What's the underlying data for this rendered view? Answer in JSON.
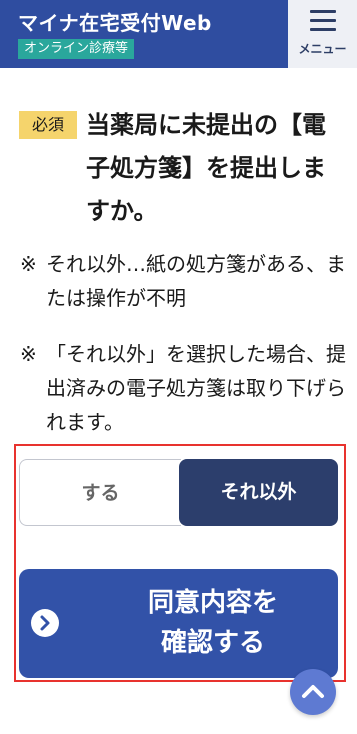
{
  "header": {
    "title": "マイナ在宅受付Web",
    "subtitle": "オンライン診療等",
    "menu_label": "メニュー",
    "menu_icon": "hamburger-icon"
  },
  "question": {
    "badge": "必須",
    "text": "当薬局に未提出の【電子処方箋】を提出しますか。"
  },
  "notes": [
    {
      "mark": "※",
      "text": "それ以外…紙の処方箋がある、または操作が不明"
    },
    {
      "mark": "※",
      "text": "「それ以外」を選択した場合、提出済みの電子処方箋は取り下げられます。"
    }
  ],
  "choices": {
    "options": [
      "する",
      "それ以外"
    ],
    "selected": "それ以外"
  },
  "confirm_button": {
    "label": "同意内容を\n確認する",
    "icon": "chevron-right-circle-icon"
  },
  "scroll_top": {
    "icon": "chevron-up-icon"
  },
  "colors": {
    "header": "#2f4da0",
    "subtitle_badge": "#2aa79c",
    "required_badge": "#f5d46c",
    "selected_choice": "#2c3e6c",
    "primary_button": "#3252a8",
    "highlight_border": "#e8322e",
    "scroll_top_button": "#5e7ad2"
  }
}
